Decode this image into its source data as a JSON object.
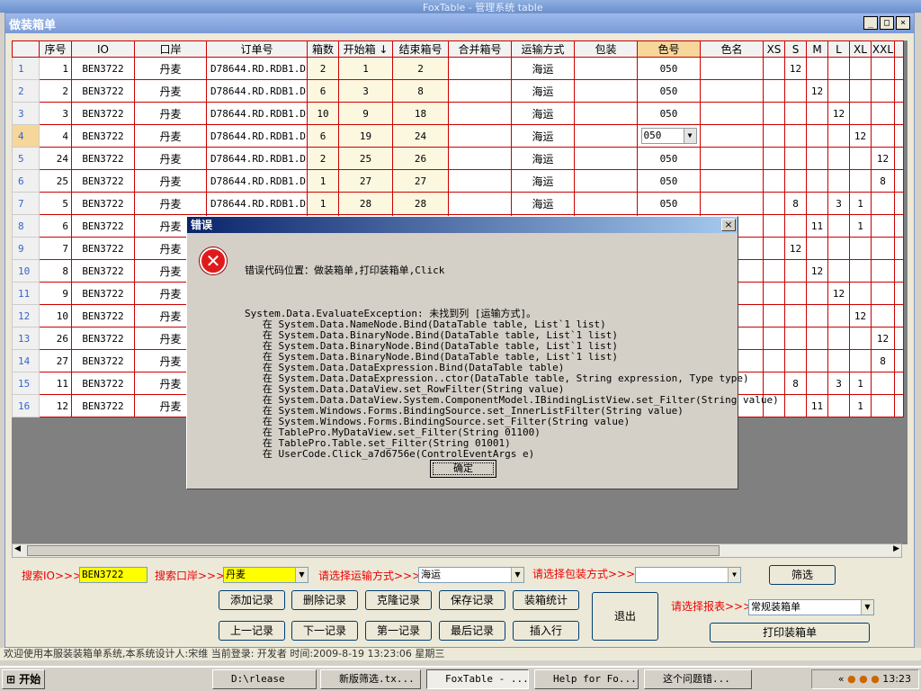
{
  "app": {
    "top_title": "FoxTable - 管理系统 table",
    "window_title": "做装箱单",
    "min_btn": "_",
    "max_btn": "□",
    "close_btn": "×"
  },
  "grid": {
    "columns": [
      "序号",
      "IO",
      "口岸",
      "订单号",
      "箱数",
      "开始箱 ↓",
      "结束箱号",
      "合并箱号",
      "运输方式",
      "包装",
      "色号",
      "色名",
      "XS",
      "S",
      "M",
      "L",
      "XL",
      "XXL",
      ""
    ],
    "rows": [
      {
        "rn": "1",
        "seq": "1",
        "io": "BEN3722",
        "port": "丹麦",
        "order": "D78644.RD.RDB1.D",
        "boxes": "2",
        "start": "1",
        "end": "2",
        "merge": "",
        "ship": "海运",
        "pack": "",
        "color": "050",
        "cname": "",
        "xs": "",
        "s": "12",
        "m": "",
        "l": "",
        "xl": "",
        "xxl": ""
      },
      {
        "rn": "2",
        "seq": "2",
        "io": "BEN3722",
        "port": "丹麦",
        "order": "D78644.RD.RDB1.D",
        "boxes": "6",
        "start": "3",
        "end": "8",
        "merge": "",
        "ship": "海运",
        "pack": "",
        "color": "050",
        "cname": "",
        "xs": "",
        "s": "",
        "m": "12",
        "l": "",
        "xl": "",
        "xxl": ""
      },
      {
        "rn": "3",
        "seq": "3",
        "io": "BEN3722",
        "port": "丹麦",
        "order": "D78644.RD.RDB1.D",
        "boxes": "10",
        "start": "9",
        "end": "18",
        "merge": "",
        "ship": "海运",
        "pack": "",
        "color": "050",
        "cname": "",
        "xs": "",
        "s": "",
        "m": "",
        "l": "12",
        "xl": "",
        "xxl": ""
      },
      {
        "rn": "4",
        "seq": "4",
        "io": "BEN3722",
        "port": "丹麦",
        "order": "D78644.RD.RDB1.D",
        "boxes": "6",
        "start": "19",
        "end": "24",
        "merge": "",
        "ship": "海运",
        "pack": "",
        "color": "050",
        "cname": "",
        "xs": "",
        "s": "",
        "m": "",
        "l": "",
        "xl": "12",
        "xxl": ""
      },
      {
        "rn": "5",
        "seq": "24",
        "io": "BEN3722",
        "port": "丹麦",
        "order": "D78644.RD.RDB1.D",
        "boxes": "2",
        "start": "25",
        "end": "26",
        "merge": "",
        "ship": "海运",
        "pack": "",
        "color": "050",
        "cname": "",
        "xs": "",
        "s": "",
        "m": "",
        "l": "",
        "xl": "",
        "xxl": "12"
      },
      {
        "rn": "6",
        "seq": "25",
        "io": "BEN3722",
        "port": "丹麦",
        "order": "D78644.RD.RDB1.D",
        "boxes": "1",
        "start": "27",
        "end": "27",
        "merge": "",
        "ship": "海运",
        "pack": "",
        "color": "050",
        "cname": "",
        "xs": "",
        "s": "",
        "m": "",
        "l": "",
        "xl": "",
        "xxl": "8"
      },
      {
        "rn": "7",
        "seq": "5",
        "io": "BEN3722",
        "port": "丹麦",
        "order": "D78644.RD.RDB1.D",
        "boxes": "1",
        "start": "28",
        "end": "28",
        "merge": "",
        "ship": "海运",
        "pack": "",
        "color": "050",
        "cname": "",
        "xs": "",
        "s": "8",
        "m": "",
        "l": "3",
        "xl": "1",
        "xxl": ""
      },
      {
        "rn": "8",
        "seq": "6",
        "io": "BEN3722",
        "port": "丹麦",
        "order": "",
        "boxes": "",
        "start": "",
        "end": "",
        "merge": "",
        "ship": "",
        "pack": "",
        "color": "",
        "cname": "",
        "xs": "",
        "s": "",
        "m": "11",
        "l": "",
        "xl": "1",
        "xxl": ""
      },
      {
        "rn": "9",
        "seq": "7",
        "io": "BEN3722",
        "port": "丹麦",
        "order": "",
        "boxes": "",
        "start": "",
        "end": "",
        "merge": "",
        "ship": "",
        "pack": "",
        "color": "",
        "cname": "",
        "xs": "",
        "s": "12",
        "m": "",
        "l": "",
        "xl": "",
        "xxl": ""
      },
      {
        "rn": "10",
        "seq": "8",
        "io": "BEN3722",
        "port": "丹麦",
        "order": "",
        "boxes": "",
        "start": "",
        "end": "",
        "merge": "",
        "ship": "",
        "pack": "",
        "color": "",
        "cname": "",
        "xs": "",
        "s": "",
        "m": "12",
        "l": "",
        "xl": "",
        "xxl": ""
      },
      {
        "rn": "11",
        "seq": "9",
        "io": "BEN3722",
        "port": "丹麦",
        "order": "",
        "boxes": "",
        "start": "",
        "end": "",
        "merge": "",
        "ship": "",
        "pack": "",
        "color": "",
        "cname": "",
        "xs": "",
        "s": "",
        "m": "",
        "l": "12",
        "xl": "",
        "xxl": ""
      },
      {
        "rn": "12",
        "seq": "10",
        "io": "BEN3722",
        "port": "丹麦",
        "order": "",
        "boxes": "",
        "start": "",
        "end": "",
        "merge": "",
        "ship": "",
        "pack": "",
        "color": "",
        "cname": "",
        "xs": "",
        "s": "",
        "m": "",
        "l": "",
        "xl": "12",
        "xxl": ""
      },
      {
        "rn": "13",
        "seq": "26",
        "io": "BEN3722",
        "port": "丹麦",
        "order": "",
        "boxes": "",
        "start": "",
        "end": "",
        "merge": "",
        "ship": "",
        "pack": "",
        "color": "",
        "cname": "",
        "xs": "",
        "s": "",
        "m": "",
        "l": "",
        "xl": "",
        "xxl": "12"
      },
      {
        "rn": "14",
        "seq": "27",
        "io": "BEN3722",
        "port": "丹麦",
        "order": "",
        "boxes": "",
        "start": "",
        "end": "",
        "merge": "",
        "ship": "",
        "pack": "",
        "color": "",
        "cname": "",
        "xs": "",
        "s": "",
        "m": "",
        "l": "",
        "xl": "",
        "xxl": "8"
      },
      {
        "rn": "15",
        "seq": "11",
        "io": "BEN3722",
        "port": "丹麦",
        "order": "",
        "boxes": "",
        "start": "",
        "end": "",
        "merge": "",
        "ship": "",
        "pack": "",
        "color": "",
        "cname": "",
        "xs": "",
        "s": "8",
        "m": "",
        "l": "3",
        "xl": "1",
        "xxl": ""
      },
      {
        "rn": "16",
        "seq": "12",
        "io": "BEN3722",
        "port": "丹麦",
        "order": "",
        "boxes": "",
        "start": "",
        "end": "",
        "merge": "",
        "ship": "",
        "pack": "",
        "color": "",
        "cname": "",
        "xs": "",
        "s": "",
        "m": "11",
        "l": "",
        "xl": "1",
        "xxl": ""
      }
    ]
  },
  "controls": {
    "search_io_label": "搜索IO>>>",
    "search_io_value": "BEN3722",
    "search_port_label": "搜索口岸>>>",
    "search_port_value": "丹麦",
    "ship_label": "请选择运输方式>>>",
    "ship_value": "海运",
    "pack_label": "请选择包装方式>>>",
    "pack_value": "",
    "filter_btn": "筛选",
    "add_btn": "添加记录",
    "delete_btn": "删除记录",
    "clone_btn": "克隆记录",
    "save_btn": "保存记录",
    "stats_btn": "装箱统计",
    "prev_btn": "上一记录",
    "next_btn": "下一记录",
    "first_btn": "第一记录",
    "last_btn": "最后记录",
    "insert_btn": "插入行",
    "exit_btn": "退出",
    "report_label": "请选择报表>>>",
    "report_value": "常规装箱单",
    "print_btn": "打印装箱单"
  },
  "status": {
    "text": "欢迎使用本服装装箱单系统,本系统设计人:宋维    当前登录: 开发者    时间:2009-8-19 13:23:06    星期三"
  },
  "taskbar": {
    "start": "开始",
    "tasks": [
      "D:\\rlease",
      "新版筛选.tx...",
      "FoxTable - ...",
      "Help for Fo...",
      "这个问题错..."
    ],
    "clock": "13:23",
    "tray_prefix": "«"
  },
  "dialog": {
    "title": "错误",
    "close": "×",
    "icon_glyph": "✕",
    "head": "错误代码位置：做装箱单,打印装箱单,Click",
    "message": "System.Data.EvaluateException: 未找到列 [运输方式]。\n   在 System.Data.NameNode.Bind(DataTable table, List`1 list)\n   在 System.Data.BinaryNode.Bind(DataTable table, List`1 list)\n   在 System.Data.BinaryNode.Bind(DataTable table, List`1 list)\n   在 System.Data.BinaryNode.Bind(DataTable table, List`1 list)\n   在 System.Data.DataExpression.Bind(DataTable table)\n   在 System.Data.DataExpression..ctor(DataTable table, String expression, Type type)\n   在 System.Data.DataView.set_RowFilter(String value)\n   在 System.Data.DataView.System.ComponentModel.IBindingListView.set_Filter(String value)\n   在 System.Windows.Forms.BindingSource.set_InnerListFilter(String value)\n   在 System.Windows.Forms.BindingSource.set_Filter(String value)\n   在 TablePro.MyDataView.set_Filter(String 01100)\n   在 TablePro.Table.set_Filter(String 01001)\n   在 UserCode.Click_a7d6756e(ControlEventArgs e)",
    "ok": "确定"
  }
}
